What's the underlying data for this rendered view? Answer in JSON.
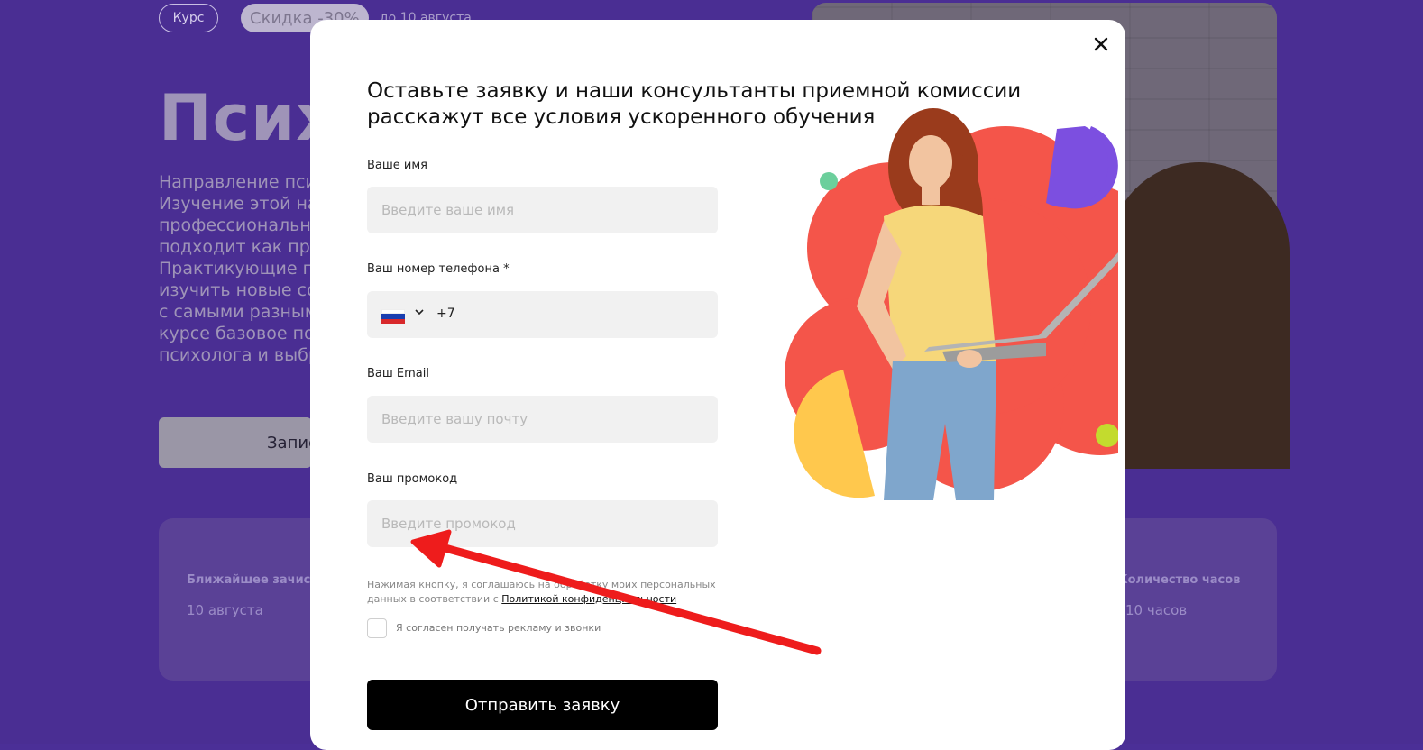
{
  "background": {
    "badge_course": "Курс",
    "badge_discount": "Скидка -30%",
    "badge_date": "до 10 августа",
    "hero_title": "Псих",
    "hero_text_lines": [
      "Направление пси",
      "Изучение этой на",
      "профессионально",
      "подходит как пра",
      "Практикующие п",
      "изучить новые со",
      "с самыми разным",
      "курсе базовое по",
      "психолога и выбр"
    ],
    "hero_button": "Запис",
    "info_left_label": "Ближайшее зачисле",
    "info_left_value": "10 августа",
    "info_right_label": "Количество часов",
    "info_right_value": "10 часов"
  },
  "modal": {
    "title_line1": "Оставьте заявку и наши консультанты приемной комиссии",
    "title_line2": "расскажут все условия ускоренного обучения",
    "name_label": "Ваше имя",
    "name_placeholder": "Введите ваше имя",
    "phone_label": "Ваш номер телефона *",
    "phone_prefix": "+7",
    "email_label": "Ваш Email",
    "email_placeholder": "Введите вашу почту",
    "promo_label": "Ваш промокод",
    "promo_placeholder": "Введите промокод",
    "consent_text": "Нажимая кнопку, я соглашаюсь на обработку моих персональных данных в соответствии с ",
    "consent_link": "Политикой конфиденциальности",
    "checkbox_label": "Я согласен получать рекламу и звонки",
    "submit_label": "Отправить заявку",
    "close_icon": "close-icon",
    "flag_icon": "russia-flag-icon"
  },
  "colors": {
    "background_purple": "#4a2e93",
    "blob_red": "#f4554a",
    "blob_yellow": "#ffc84d",
    "blob_purple": "#7c4fe0",
    "dot_green": "#6ccf9c",
    "dot_lime": "#c3db2e",
    "arrow_red": "#ee1c1c"
  }
}
